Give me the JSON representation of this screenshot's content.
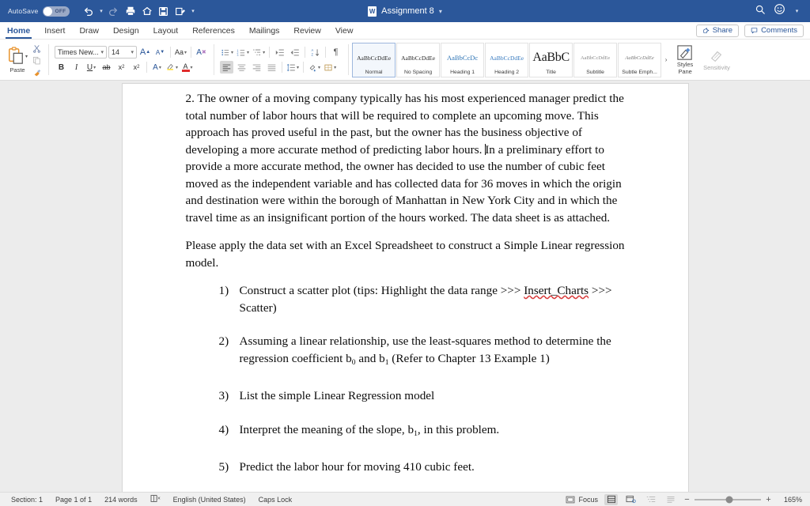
{
  "titlebar": {
    "autosave_label": "AutoSave",
    "autosave_state": "OFF",
    "doc_title": "Assignment 8",
    "quick_access": [
      {
        "name": "undo-icon",
        "label": "Undo"
      },
      {
        "name": "redo-icon",
        "label": "Redo"
      },
      {
        "name": "print-icon",
        "label": "Print"
      },
      {
        "name": "home-icon",
        "label": "Home"
      },
      {
        "name": "save-icon",
        "label": "Save"
      },
      {
        "name": "edit-icon",
        "label": "Editing"
      }
    ],
    "search_label": "Search",
    "account_label": "Account"
  },
  "tabs": [
    {
      "label": "Home",
      "active": true
    },
    {
      "label": "Insert",
      "active": false
    },
    {
      "label": "Draw",
      "active": false
    },
    {
      "label": "Design",
      "active": false
    },
    {
      "label": "Layout",
      "active": false
    },
    {
      "label": "References",
      "active": false
    },
    {
      "label": "Mailings",
      "active": false
    },
    {
      "label": "Review",
      "active": false
    },
    {
      "label": "View",
      "active": false
    }
  ],
  "tabbar_right": {
    "share_label": "Share",
    "comments_label": "Comments"
  },
  "ribbon": {
    "clipboard": {
      "paste_label": "Paste",
      "cut_label": "Cut",
      "copy_label": "Copy",
      "format_painter_label": "Format Painter"
    },
    "font": {
      "font_name": "Times New...",
      "font_size": "14",
      "grow_label": "A",
      "shrink_label": "A",
      "change_case_label": "Aa",
      "clear_formatting_label": "A",
      "bold_label": "B",
      "italic_label": "I",
      "underline_label": "U",
      "strikethrough_label": "ab",
      "subscript_label": "x",
      "superscript_label": "x",
      "text_effects_label": "A",
      "highlight_label": "A",
      "font_color_label": "A"
    },
    "paragraph": {
      "bullets_label": "Bullets",
      "numbering_label": "Numbering",
      "multilevel_label": "Multilevel List",
      "decrease_indent_label": "Decrease Indent",
      "increase_indent_label": "Increase Indent",
      "sort_label": "Sort",
      "show_marks_label": "¶",
      "align_left_label": "Align Left",
      "align_center_label": "Center",
      "align_right_label": "Align Right",
      "justify_label": "Justify",
      "line_spacing_label": "Line Spacing",
      "shading_label": "Shading",
      "borders_label": "Borders"
    },
    "styles": [
      {
        "preview": "AaBbCcDdEe",
        "name": "Normal",
        "variant": "normal",
        "selected": true
      },
      {
        "preview": "AaBbCcDdEe",
        "name": "No Spacing",
        "variant": "normal",
        "selected": false
      },
      {
        "preview": "AaBbCcDc",
        "name": "Heading 1",
        "variant": "h1",
        "selected": false
      },
      {
        "preview": "AaBbCcDdEe",
        "name": "Heading 2",
        "variant": "h2",
        "selected": false
      },
      {
        "preview": "AaBbC",
        "name": "Title",
        "variant": "title",
        "selected": false
      },
      {
        "preview": "AaBbCcDdEe",
        "name": "Subtitle",
        "variant": "sub",
        "selected": false
      },
      {
        "preview": "AaBbCcDdEe",
        "name": "Subtle Emph...",
        "variant": "semph",
        "selected": false
      }
    ],
    "gallery_more_label": "›",
    "styles_pane": {
      "line1": "Styles",
      "line2": "Pane"
    },
    "sensitivity": {
      "label": "Sensitivity"
    }
  },
  "document": {
    "paragraph1": "2. The owner of a moving company typically has his most experienced manager predict the total number of labor hours that will be required to complete an upcoming move. This approach has proved useful in the past, but the owner has the business objective of developing a more accurate method of predicting labor hours.",
    "paragraph1b": "In a preliminary effort to provide a more accurate method, the owner has decided to use the number of cubic feet moved as the independent variable and has collected data for 36 moves in which the origin and destination were within the borough of Manhattan in New York City and in which the travel time as an insignificant portion of the hours worked. The data sheet is as attached.",
    "paragraph2": "Please apply the data set with an Excel Spreadsheet to construct a Simple Linear regression model.",
    "items": [
      {
        "number": "1)",
        "text_before": "Construct a scatter plot (tips: Highlight the data range >>> ",
        "misspelled": "Insert_Charts",
        "text_after": " >>> Scatter)"
      },
      {
        "number": "2)",
        "text_a": "Assuming a linear relationship, use the least-squares method to determine the regression coefficient b",
        "sub_a": "0",
        "text_b": " and b",
        "sub_b": "1",
        "text_c": " (Refer to Chapter 13 Example 1)"
      },
      {
        "number": "3)",
        "text_a": "List the simple Linear Regression model"
      },
      {
        "number": "4)",
        "text_a": "Interpret the meaning of the slope, b",
        "sub_a": "1",
        "text_b": ", in this problem."
      },
      {
        "number": "5)",
        "text_a": "Predict the labor hour for moving 410 cubic feet."
      }
    ]
  },
  "statusbar": {
    "section": "Section: 1",
    "page": "Page 1 of 1",
    "words": "214 words",
    "proofing_label": "Proofing errors",
    "language": "English (United States)",
    "caps_lock": "Caps Lock",
    "focus_label": "Focus",
    "view_print_label": "Print Layout",
    "view_web_label": "Web Layout",
    "view_outline_label": "Outline",
    "view_draft_label": "Draft",
    "zoom_out_label": "−",
    "zoom_in_label": "+",
    "zoom_value": "165%"
  },
  "colors": {
    "brand": "#2b579a",
    "canvas": "#ececec",
    "accent_orange": "#e8922c",
    "spell_error": "#d83b3b"
  }
}
